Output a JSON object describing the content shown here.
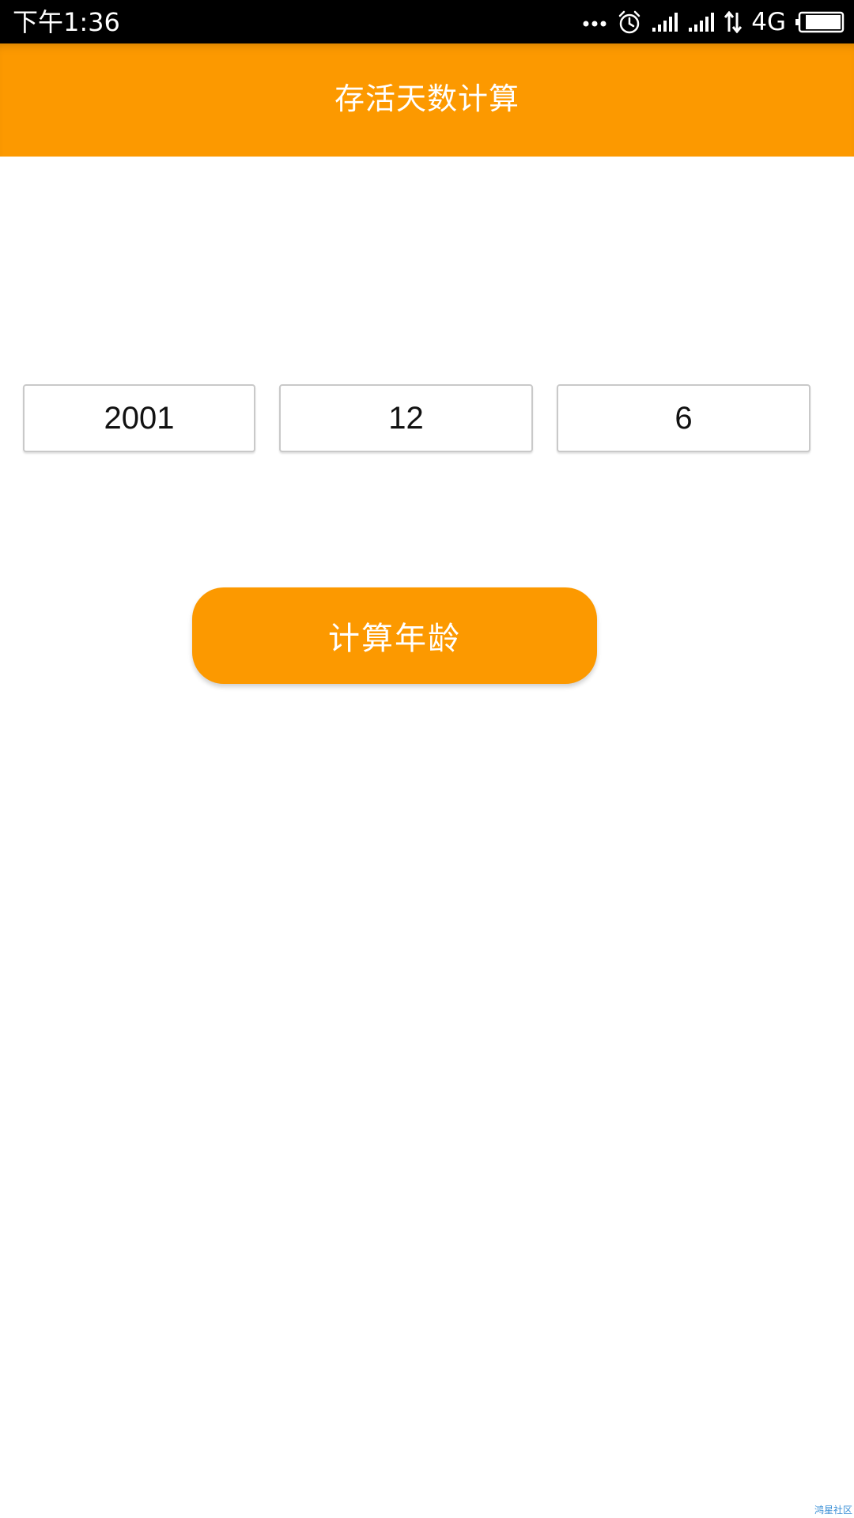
{
  "status_bar": {
    "time": "下午1:36",
    "network": "4G",
    "icons": [
      "more-dots-icon",
      "alarm-icon",
      "signal-icon",
      "signal-icon",
      "data-transfer-icon",
      "battery-icon"
    ]
  },
  "app_bar": {
    "title": "存活天数计算"
  },
  "form": {
    "year": "2001",
    "month": "12",
    "day": "6",
    "button_label": "计算年龄"
  },
  "watermark": "鸿星社区",
  "colors": {
    "accent": "#fc9900",
    "status_bar": "#000000",
    "background": "#ffffff"
  }
}
